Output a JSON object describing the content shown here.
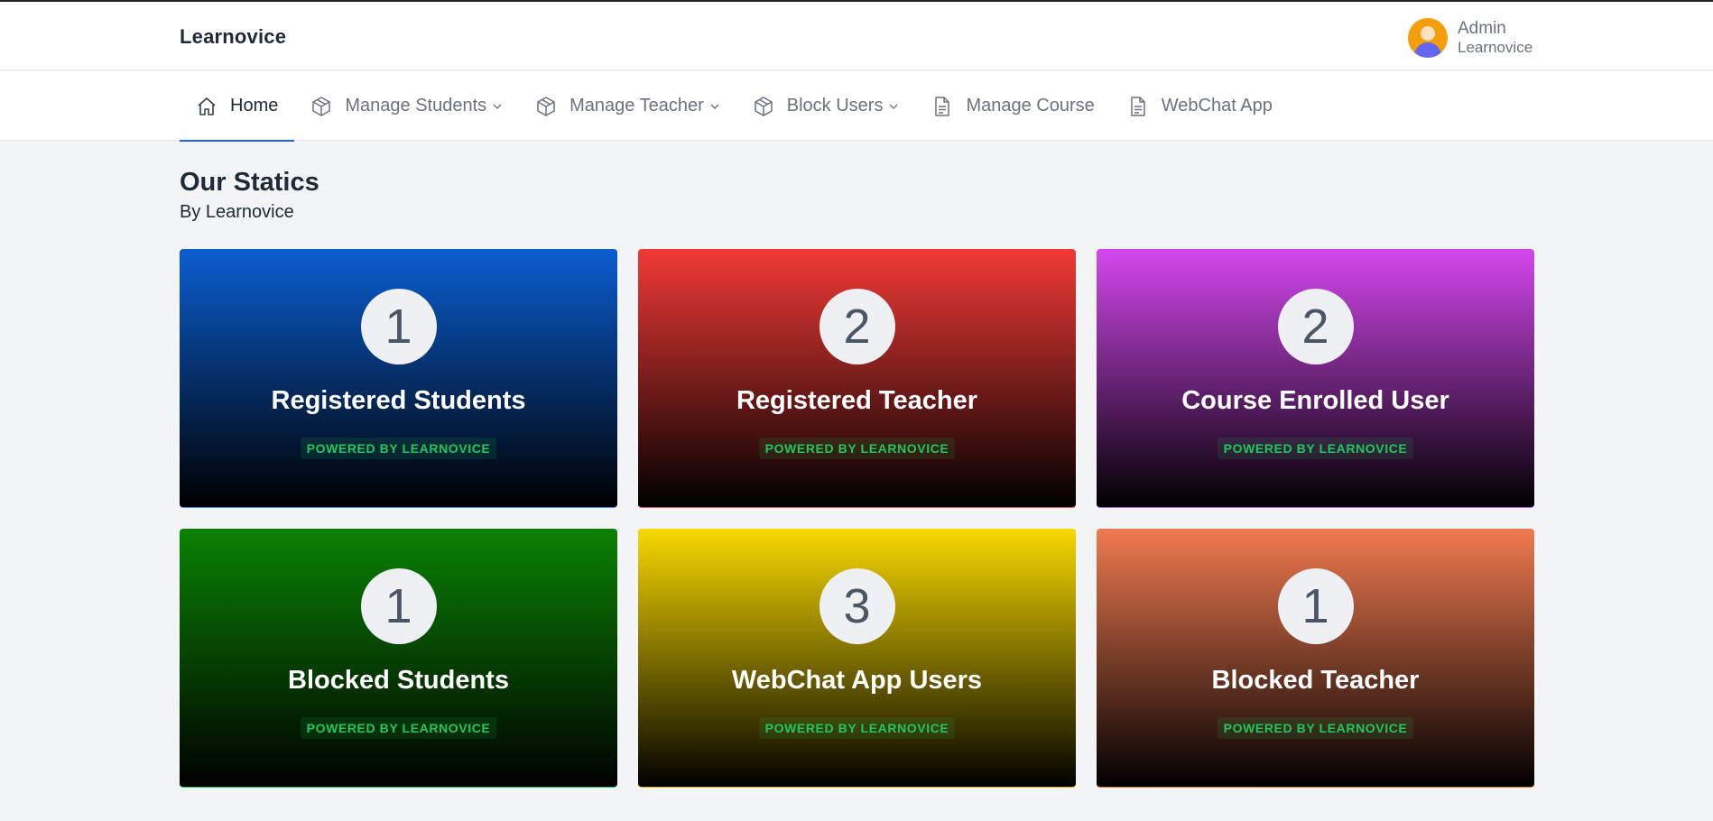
{
  "header": {
    "brand": "Learnovice",
    "user": {
      "name": "Admin",
      "org": "Learnovice"
    }
  },
  "nav": {
    "items": [
      {
        "label": "Home",
        "icon": "home-icon",
        "active": true
      },
      {
        "label": "Manage Students",
        "icon": "cube-icon",
        "dropdown": true
      },
      {
        "label": "Manage Teacher",
        "icon": "cube-icon",
        "dropdown": true
      },
      {
        "label": "Block Users",
        "icon": "cube-icon",
        "dropdown": true
      },
      {
        "label": "Manage Course",
        "icon": "document-icon"
      },
      {
        "label": "WebChat App",
        "icon": "document-icon"
      }
    ]
  },
  "page": {
    "title": "Our Statics",
    "subtitle": "By Learnovice"
  },
  "cards": [
    {
      "count": "1",
      "title": "Registered Students",
      "badge": "POWERED BY LEARNOVICE",
      "color": "#0a5dd0"
    },
    {
      "count": "2",
      "title": "Registered Teacher",
      "badge": "POWERED BY LEARNOVICE",
      "color": "#f23a36"
    },
    {
      "count": "2",
      "title": "Course Enrolled User",
      "badge": "POWERED BY LEARNOVICE",
      "color": "#d447ef"
    },
    {
      "count": "1",
      "title": "Blocked Students",
      "badge": "POWERED BY LEARNOVICE",
      "color": "#0a8203"
    },
    {
      "count": "3",
      "title": "WebChat App Users",
      "badge": "POWERED BY LEARNOVICE",
      "color": "#f8d900"
    },
    {
      "count": "1",
      "title": "Blocked Teacher",
      "badge": "POWERED BY LEARNOVICE",
      "color": "#f07a4f"
    }
  ],
  "colors": {
    "accent": "#2563eb",
    "badge_text": "#22c55e",
    "page_bg": "#f3f4f6"
  }
}
